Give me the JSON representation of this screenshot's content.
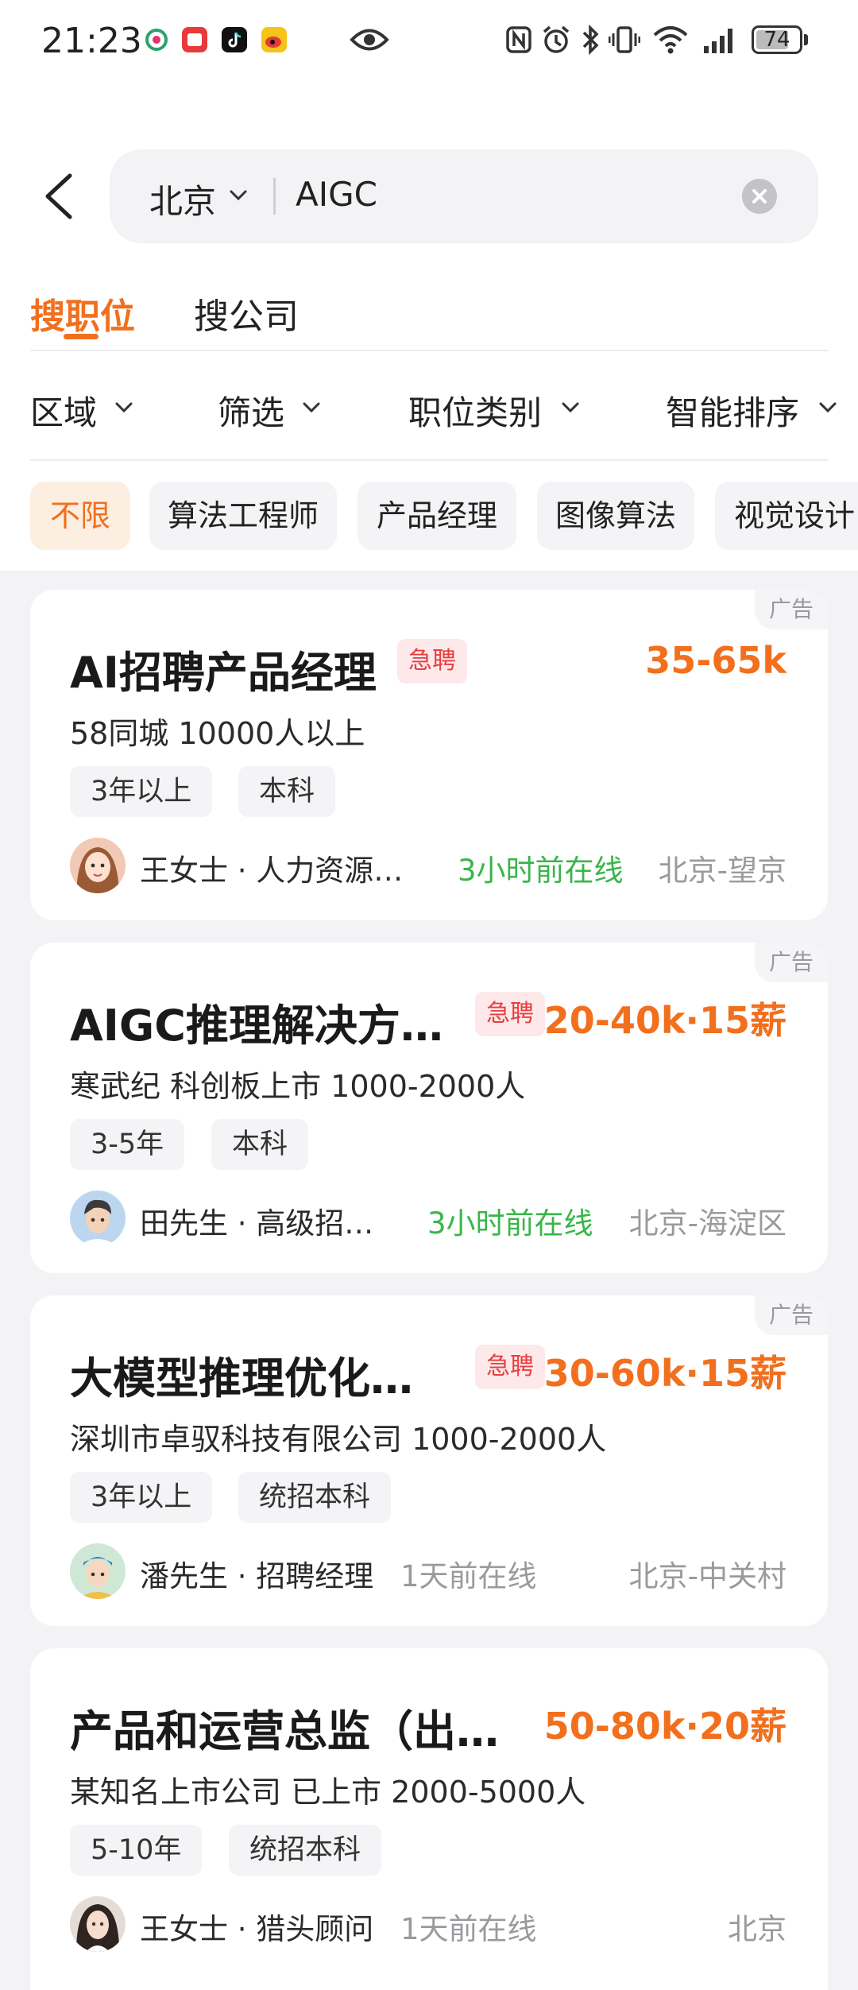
{
  "status_bar": {
    "time": "21:23",
    "battery": "74",
    "app_icons": [
      "china-mobile-icon",
      "red-app-icon",
      "tiktok-icon",
      "weibo-icon"
    ],
    "system_icons": [
      "nfc-icon",
      "alarm-icon",
      "bluetooth-icon",
      "vibrate-icon",
      "wifi-icon",
      "signal-icon"
    ]
  },
  "search": {
    "city": "北京",
    "query": "AIGC"
  },
  "tabs": [
    {
      "label": "搜职位",
      "active": true
    },
    {
      "label": "搜公司",
      "active": false
    }
  ],
  "filters": [
    {
      "label": "区域"
    },
    {
      "label": "筛选"
    },
    {
      "label": "职位类别"
    },
    {
      "label": "智能排序"
    }
  ],
  "chips": [
    {
      "label": "不限",
      "active": true
    },
    {
      "label": "算法工程师"
    },
    {
      "label": "产品经理"
    },
    {
      "label": "图像算法"
    },
    {
      "label": "视觉设计"
    }
  ],
  "jobs": [
    {
      "ad_label": "广告",
      "title": "AI招聘产品经理",
      "urgent": "急聘",
      "salary": "35-65k",
      "company": "58同城  10000人以上",
      "tags": [
        "3年以上",
        "本科"
      ],
      "recruiter": "王女士 · 人力资源…",
      "online": "3小时前在线",
      "location": "北京-望京"
    },
    {
      "ad_label": "广告",
      "title": "AIGC推理解决方…",
      "urgent": "急聘",
      "salary": "20-40k·15薪",
      "company": "寒武纪  科创板上市  1000-2000人",
      "tags": [
        "3-5年",
        "本科"
      ],
      "recruiter": "田先生 · 高级招…",
      "online": "3小时前在线",
      "location": "北京-海淀区"
    },
    {
      "ad_label": "广告",
      "title": "大模型推理优化…",
      "urgent": "急聘",
      "salary": "30-60k·15薪",
      "company": "深圳市卓驭科技有限公司  1000-2000人",
      "tags": [
        "3年以上",
        "统招本科"
      ],
      "recruiter": "潘先生 · 招聘经理",
      "online": "1天前在线",
      "location": "北京-中关村"
    },
    {
      "title": "产品和运营总监（出…",
      "salary": "50-80k·20薪",
      "company": "某知名上市公司  已上市  2000-5000人",
      "tags": [
        "5-10年",
        "统招本科"
      ],
      "recruiter": "王女士 · 猎头顾问",
      "online": "1天前在线",
      "location": "北京"
    }
  ],
  "colors": {
    "accent": "#f26f1d",
    "urgent": "#e93e3e",
    "online_recent": "#39b54a",
    "muted": "#9a9a9e"
  }
}
